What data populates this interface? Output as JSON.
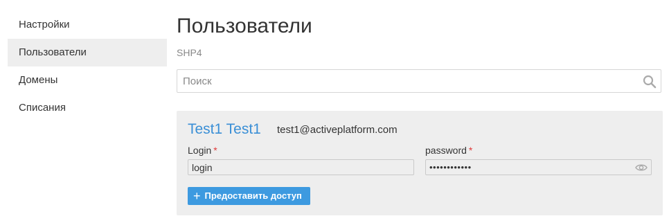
{
  "sidebar": {
    "items": [
      {
        "label": "Настройки"
      },
      {
        "label": "Пользователи",
        "active": true
      },
      {
        "label": "Домены"
      },
      {
        "label": "Списания"
      }
    ]
  },
  "main": {
    "title": "Пользователи",
    "subtitle": "SHP4",
    "search": {
      "placeholder": "Поиск",
      "value": ""
    },
    "user": {
      "name": "Test1 Test1",
      "email": "test1@activeplatform.com",
      "login": {
        "label": "Login",
        "required_mark": "*",
        "value": "login"
      },
      "password": {
        "label": "password",
        "required_mark": "*",
        "masked_value": "••••••••••••"
      },
      "grant_button_label": "Предоставить доступ"
    }
  },
  "colors": {
    "accent": "#3d9ae0",
    "link": "#3a8fd6",
    "required": "#e03a3a",
    "card_bg": "#eeeeee"
  },
  "icons": {
    "search": "search-icon",
    "eye": "eye-icon",
    "plus": "plus-icon"
  }
}
